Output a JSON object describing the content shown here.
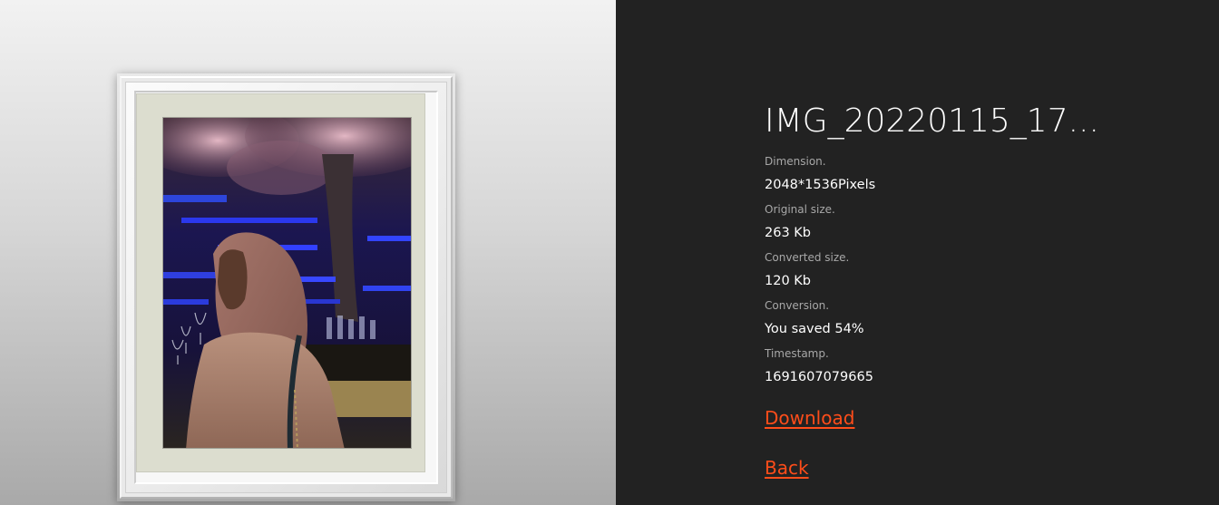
{
  "image": {
    "description_icon": "portrait-photo",
    "frame_color": "#ececec",
    "mat_color": "#dcddcf"
  },
  "details": {
    "title": "IMG_20220115_17...",
    "dimension_label": "Dimension.",
    "dimension_value": "2048*1536Pixels",
    "original_size_label": "Original size.",
    "original_size_value": "263 Kb",
    "converted_size_label": "Converted size.",
    "converted_size_value": "120 Kb",
    "conversion_label": "Conversion.",
    "conversion_value": "You saved 54%",
    "timestamp_label": "Timestamp.",
    "timestamp_value": "1691607079665"
  },
  "actions": {
    "download_label": "Download",
    "back_label": "Back"
  },
  "colors": {
    "panel_background": "#222222",
    "link_accent": "#ff4d1a",
    "label_gray": "#a8a8a8"
  }
}
